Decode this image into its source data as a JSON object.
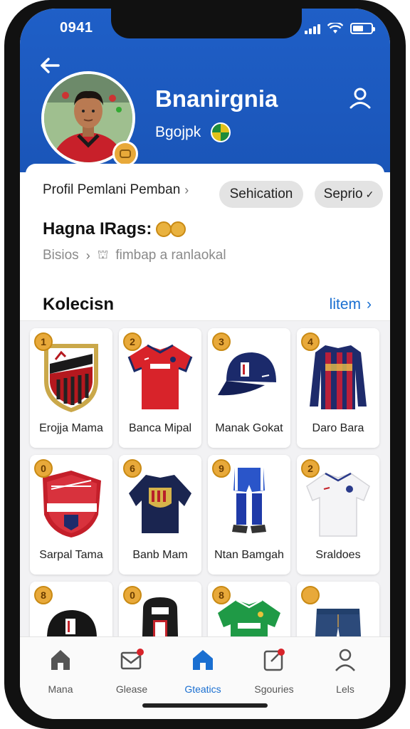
{
  "status": {
    "time": "0941"
  },
  "header": {
    "name": "Bnanirgnia",
    "subtitle": "Bgojpk",
    "back_icon": "arrow-left-icon",
    "profile_icon": "person-icon",
    "colors": {
      "primary": "#1f5fc7",
      "accent": "#e8a93a"
    }
  },
  "card": {
    "breadcrumb": "Profil Pemlani Pemban",
    "chip_1": "Sehication",
    "chip_2": "Seprio",
    "tag_title": "Hagna IRags:",
    "sub_1": "Bisios",
    "sub_2": "fimbap a ranlaokal",
    "section_title": "Kolecisn",
    "section_link": "litem"
  },
  "items": [
    {
      "badge": "1",
      "label": "Erojja Mama",
      "icon": "shield-crest-icon"
    },
    {
      "badge": "2",
      "label": "Banca Mipal",
      "icon": "red-jersey-icon"
    },
    {
      "badge": "3",
      "label": "Manak Gokat",
      "icon": "cap-icon"
    },
    {
      "badge": "4",
      "label": "Daro Bara",
      "icon": "striped-jersey-icon"
    },
    {
      "badge": "0",
      "label": "Sarpal Tama",
      "icon": "red-crest-icon"
    },
    {
      "badge": "6",
      "label": "Banb Mam",
      "icon": "navy-jersey-icon"
    },
    {
      "badge": "9",
      "label": "Ntan Bamgah",
      "icon": "kit-icon"
    },
    {
      "badge": "2",
      "label": "Sraldoes",
      "icon": "white-jersey-icon"
    },
    {
      "badge": "8",
      "label": "",
      "icon": "black-cap-icon"
    },
    {
      "badge": "0",
      "label": "",
      "icon": "backpack-icon"
    },
    {
      "badge": "8",
      "label": "",
      "icon": "green-jersey-icon"
    },
    {
      "badge": "",
      "label": "",
      "icon": "jeans-icon"
    }
  ],
  "nav": [
    {
      "label": "Mana",
      "icon": "home-icon"
    },
    {
      "label": "Glease",
      "icon": "mail-icon"
    },
    {
      "label": "Gteatics",
      "icon": "house-icon"
    },
    {
      "label": "Sgouries",
      "icon": "edit-icon"
    },
    {
      "label": "Lels",
      "icon": "person-icon"
    }
  ]
}
